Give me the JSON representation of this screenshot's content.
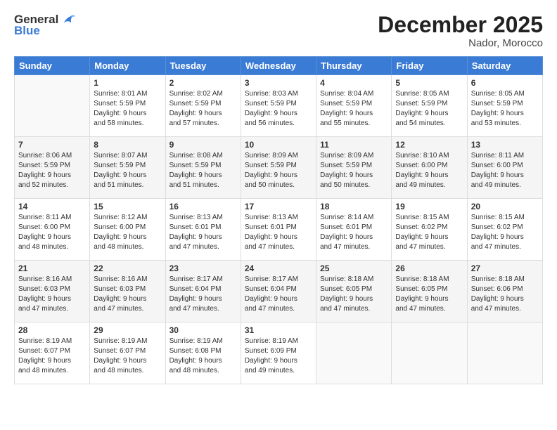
{
  "logo": {
    "general": "General",
    "blue": "Blue"
  },
  "title": "December 2025",
  "subtitle": "Nador, Morocco",
  "days": [
    "Sunday",
    "Monday",
    "Tuesday",
    "Wednesday",
    "Thursday",
    "Friday",
    "Saturday"
  ],
  "weeks": [
    [
      {
        "day": "",
        "info": ""
      },
      {
        "day": "1",
        "info": "Sunrise: 8:01 AM\nSunset: 5:59 PM\nDaylight: 9 hours\nand 58 minutes."
      },
      {
        "day": "2",
        "info": "Sunrise: 8:02 AM\nSunset: 5:59 PM\nDaylight: 9 hours\nand 57 minutes."
      },
      {
        "day": "3",
        "info": "Sunrise: 8:03 AM\nSunset: 5:59 PM\nDaylight: 9 hours\nand 56 minutes."
      },
      {
        "day": "4",
        "info": "Sunrise: 8:04 AM\nSunset: 5:59 PM\nDaylight: 9 hours\nand 55 minutes."
      },
      {
        "day": "5",
        "info": "Sunrise: 8:05 AM\nSunset: 5:59 PM\nDaylight: 9 hours\nand 54 minutes."
      },
      {
        "day": "6",
        "info": "Sunrise: 8:05 AM\nSunset: 5:59 PM\nDaylight: 9 hours\nand 53 minutes."
      }
    ],
    [
      {
        "day": "7",
        "info": "Sunrise: 8:06 AM\nSunset: 5:59 PM\nDaylight: 9 hours\nand 52 minutes."
      },
      {
        "day": "8",
        "info": "Sunrise: 8:07 AM\nSunset: 5:59 PM\nDaylight: 9 hours\nand 51 minutes."
      },
      {
        "day": "9",
        "info": "Sunrise: 8:08 AM\nSunset: 5:59 PM\nDaylight: 9 hours\nand 51 minutes."
      },
      {
        "day": "10",
        "info": "Sunrise: 8:09 AM\nSunset: 5:59 PM\nDaylight: 9 hours\nand 50 minutes."
      },
      {
        "day": "11",
        "info": "Sunrise: 8:09 AM\nSunset: 5:59 PM\nDaylight: 9 hours\nand 50 minutes."
      },
      {
        "day": "12",
        "info": "Sunrise: 8:10 AM\nSunset: 6:00 PM\nDaylight: 9 hours\nand 49 minutes."
      },
      {
        "day": "13",
        "info": "Sunrise: 8:11 AM\nSunset: 6:00 PM\nDaylight: 9 hours\nand 49 minutes."
      }
    ],
    [
      {
        "day": "14",
        "info": "Sunrise: 8:11 AM\nSunset: 6:00 PM\nDaylight: 9 hours\nand 48 minutes."
      },
      {
        "day": "15",
        "info": "Sunrise: 8:12 AM\nSunset: 6:00 PM\nDaylight: 9 hours\nand 48 minutes."
      },
      {
        "day": "16",
        "info": "Sunrise: 8:13 AM\nSunset: 6:01 PM\nDaylight: 9 hours\nand 47 minutes."
      },
      {
        "day": "17",
        "info": "Sunrise: 8:13 AM\nSunset: 6:01 PM\nDaylight: 9 hours\nand 47 minutes."
      },
      {
        "day": "18",
        "info": "Sunrise: 8:14 AM\nSunset: 6:01 PM\nDaylight: 9 hours\nand 47 minutes."
      },
      {
        "day": "19",
        "info": "Sunrise: 8:15 AM\nSunset: 6:02 PM\nDaylight: 9 hours\nand 47 minutes."
      },
      {
        "day": "20",
        "info": "Sunrise: 8:15 AM\nSunset: 6:02 PM\nDaylight: 9 hours\nand 47 minutes."
      }
    ],
    [
      {
        "day": "21",
        "info": "Sunrise: 8:16 AM\nSunset: 6:03 PM\nDaylight: 9 hours\nand 47 minutes."
      },
      {
        "day": "22",
        "info": "Sunrise: 8:16 AM\nSunset: 6:03 PM\nDaylight: 9 hours\nand 47 minutes."
      },
      {
        "day": "23",
        "info": "Sunrise: 8:17 AM\nSunset: 6:04 PM\nDaylight: 9 hours\nand 47 minutes."
      },
      {
        "day": "24",
        "info": "Sunrise: 8:17 AM\nSunset: 6:04 PM\nDaylight: 9 hours\nand 47 minutes."
      },
      {
        "day": "25",
        "info": "Sunrise: 8:18 AM\nSunset: 6:05 PM\nDaylight: 9 hours\nand 47 minutes."
      },
      {
        "day": "26",
        "info": "Sunrise: 8:18 AM\nSunset: 6:05 PM\nDaylight: 9 hours\nand 47 minutes."
      },
      {
        "day": "27",
        "info": "Sunrise: 8:18 AM\nSunset: 6:06 PM\nDaylight: 9 hours\nand 47 minutes."
      }
    ],
    [
      {
        "day": "28",
        "info": "Sunrise: 8:19 AM\nSunset: 6:07 PM\nDaylight: 9 hours\nand 48 minutes."
      },
      {
        "day": "29",
        "info": "Sunrise: 8:19 AM\nSunset: 6:07 PM\nDaylight: 9 hours\nand 48 minutes."
      },
      {
        "day": "30",
        "info": "Sunrise: 8:19 AM\nSunset: 6:08 PM\nDaylight: 9 hours\nand 48 minutes."
      },
      {
        "day": "31",
        "info": "Sunrise: 8:19 AM\nSunset: 6:09 PM\nDaylight: 9 hours\nand 49 minutes."
      },
      {
        "day": "",
        "info": ""
      },
      {
        "day": "",
        "info": ""
      },
      {
        "day": "",
        "info": ""
      }
    ]
  ]
}
